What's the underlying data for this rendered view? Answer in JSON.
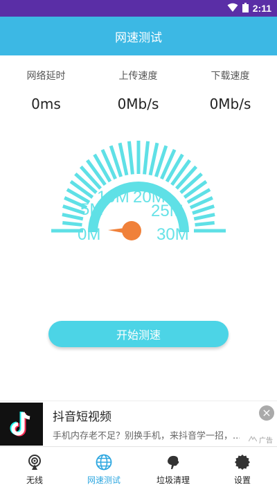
{
  "status_bar": {
    "time": "2:11",
    "background": "#5a2ea6"
  },
  "header": {
    "title": "网速测试",
    "background": "#3cb8e4"
  },
  "metrics": [
    {
      "label": "网络延时",
      "value": "0ms"
    },
    {
      "label": "上传速度",
      "value": "0Mb/s"
    },
    {
      "label": "下载速度",
      "value": "0Mb/s"
    }
  ],
  "gauge": {
    "labels": [
      "0M",
      "5M",
      "10M",
      "20M",
      "25M",
      "30M"
    ],
    "needle_value": 0,
    "color_bars": "#5fe0e6",
    "color_needle": "#f0813a"
  },
  "start_button": {
    "label": "开始测速"
  },
  "ad": {
    "title": "抖音短视频",
    "description": "手机内存老不足？别换手机，来抖音学一招，...",
    "tag": "广告"
  },
  "tabs": [
    {
      "label": "无线",
      "icon": "wifi-radar-icon",
      "active": false
    },
    {
      "label": "网速测试",
      "icon": "globe-icon",
      "active": true
    },
    {
      "label": "垃圾清理",
      "icon": "broom-icon",
      "active": false
    },
    {
      "label": "设置",
      "icon": "gear-icon",
      "active": false
    }
  ]
}
